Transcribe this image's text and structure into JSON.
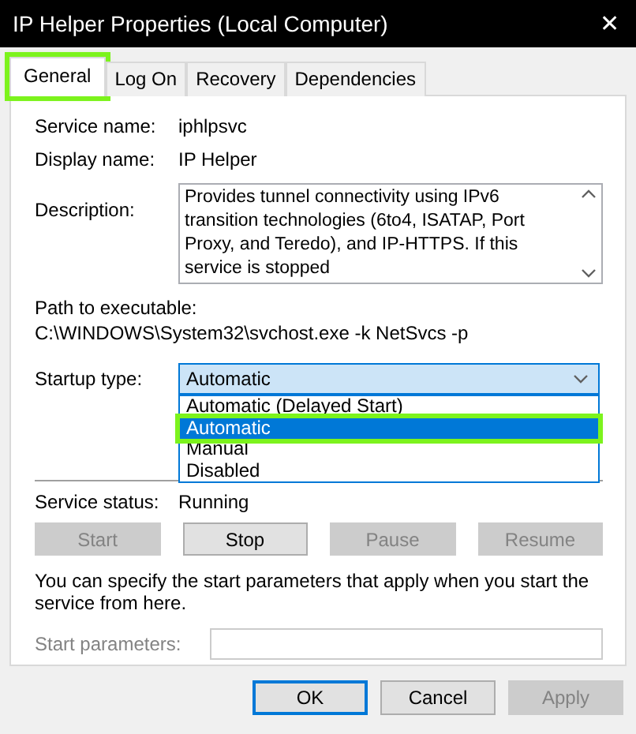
{
  "window": {
    "title": "IP Helper Properties (Local Computer)",
    "close": "✕"
  },
  "tabs": [
    {
      "label": "General",
      "selected": true,
      "highlighted": true
    },
    {
      "label": "Log On",
      "selected": false,
      "highlighted": false
    },
    {
      "label": "Recovery",
      "selected": false,
      "highlighted": false
    },
    {
      "label": "Dependencies",
      "selected": false,
      "highlighted": false
    }
  ],
  "fields": [
    {
      "label": "Service name:",
      "value": "iphlpsvc"
    },
    {
      "label": "Display name:",
      "value": "IP Helper"
    }
  ],
  "description": {
    "label": "Description:",
    "text": "Provides tunnel connectivity using IPv6 transition technologies (6to4, ISATAP, Port Proxy, and Teredo), and IP-HTTPS. If this service is stopped"
  },
  "path": {
    "label": "Path to executable:",
    "value": "C:\\WINDOWS\\System32\\svchost.exe -k NetSvcs -p"
  },
  "startup_type": {
    "label": "Startup type:",
    "value": "Automatic",
    "expanded": true,
    "options": [
      {
        "label": "Automatic (Delayed Start)",
        "selected": false,
        "highlighted": false
      },
      {
        "label": "Automatic",
        "selected": true,
        "highlighted": true
      },
      {
        "label": "Manual",
        "selected": false,
        "highlighted": false
      },
      {
        "label": "Disabled",
        "selected": false,
        "highlighted": false
      }
    ]
  },
  "service_status": {
    "label": "Service status:",
    "value": "Running"
  },
  "service_buttons": [
    {
      "label": "Start",
      "disabled": true
    },
    {
      "label": "Stop",
      "disabled": false
    },
    {
      "label": "Pause",
      "disabled": true
    },
    {
      "label": "Resume",
      "disabled": true
    }
  ],
  "note": "You can specify the start parameters that apply when you start the service from here.",
  "start_parameters": {
    "label": "Start parameters:",
    "disabled": true
  },
  "dialog_buttons": [
    {
      "label": "OK",
      "focused": true,
      "disabled": false
    },
    {
      "label": "Cancel",
      "focused": false,
      "disabled": false
    },
    {
      "label": "Apply",
      "focused": false,
      "disabled": true
    }
  ]
}
